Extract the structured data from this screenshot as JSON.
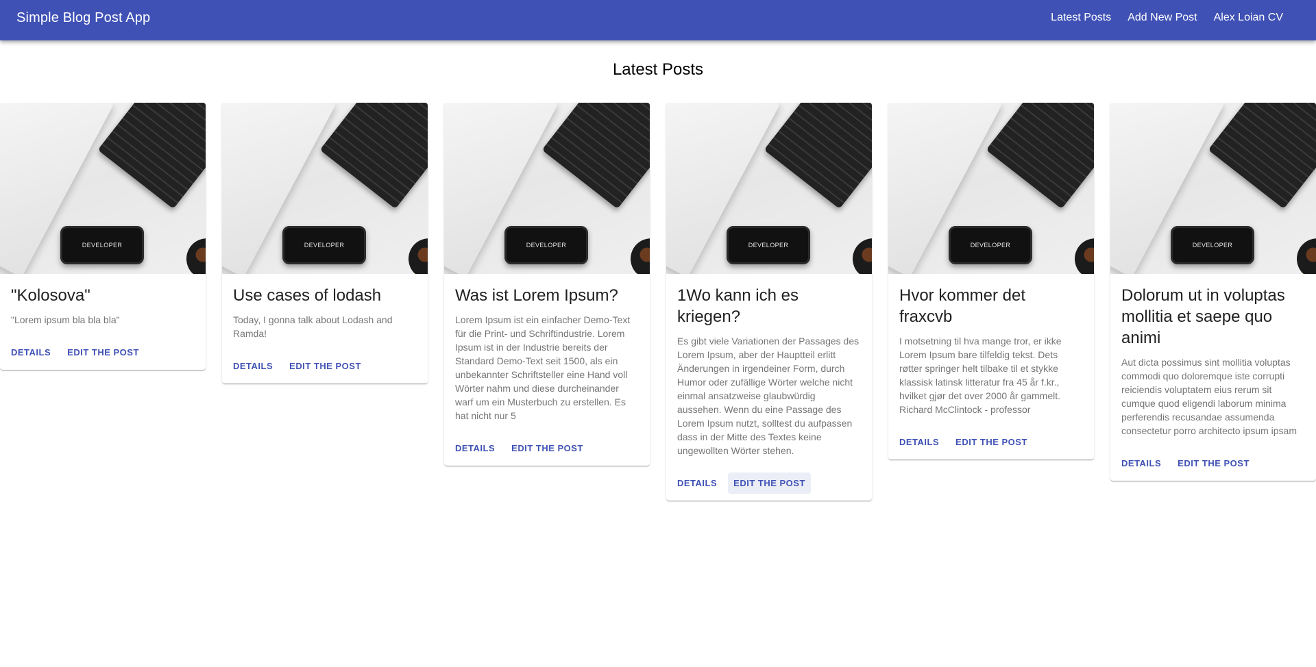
{
  "app": {
    "title": "Simple Blog Post App",
    "nav": [
      "Latest Posts",
      "Add New Post",
      "Alex Loian CV"
    ]
  },
  "page": {
    "heading": "Latest Posts"
  },
  "colors": {
    "primary": "#3f51b5",
    "text_primary": "#212121",
    "text_secondary": "#757575"
  },
  "media": {
    "phone_label": "DEVELOPER"
  },
  "actions": {
    "details": "Details",
    "edit": "Edit the post"
  },
  "posts": [
    {
      "title": "\"Kolosova\"",
      "body": "\"Lorem ipsum bla bla bla\""
    },
    {
      "title": "Use cases of lodash",
      "body": "Today, I gonna talk about Lodash and Ramda!"
    },
    {
      "title": "Was ist Lorem Ipsum?",
      "body": "Lorem Ipsum ist ein einfacher Demo-Text für die Print- und Schriftindustrie. Lorem Ipsum ist in der Industrie bereits der Standard Demo-Text seit 1500, als ein unbekannter Schriftsteller eine Hand voll Wörter nahm und diese durcheinander warf um ein Musterbuch zu erstellen. Es hat nicht nur 5"
    },
    {
      "title": "1Wo kann ich es kriegen?",
      "body": "Es gibt viele Variationen der Passages des Lorem Ipsum, aber der Hauptteil erlitt Änderungen in irgendeiner Form, durch Humor oder zufällige Wörter welche nicht einmal ansatzweise glaubwürdig aussehen. Wenn du eine Passage des Lorem Ipsum nutzt, solltest du aufpassen dass in der Mitte des Textes keine ungewollten Wörter stehen."
    },
    {
      "title": "Hvor kommer det fraxcvb",
      "body": "I motsetning til hva mange tror, er ikke Lorem Ipsum bare tilfeldig tekst. Dets røtter springer helt tilbake til et stykke klassisk latinsk litteratur fra 45 år f.kr., hvilket gjør det over 2000 år gammelt. Richard McClintock - professor"
    },
    {
      "title": "Dolorum ut in voluptas mollitia et saepe quo animi",
      "body": "Aut dicta possimus sint mollitia voluptas commodi quo doloremque iste corrupti reiciendis voluptatem eius rerum sit cumque quod eligendi laborum minima perferendis recusandae assumenda consectetur porro architecto ipsum ipsam"
    }
  ]
}
